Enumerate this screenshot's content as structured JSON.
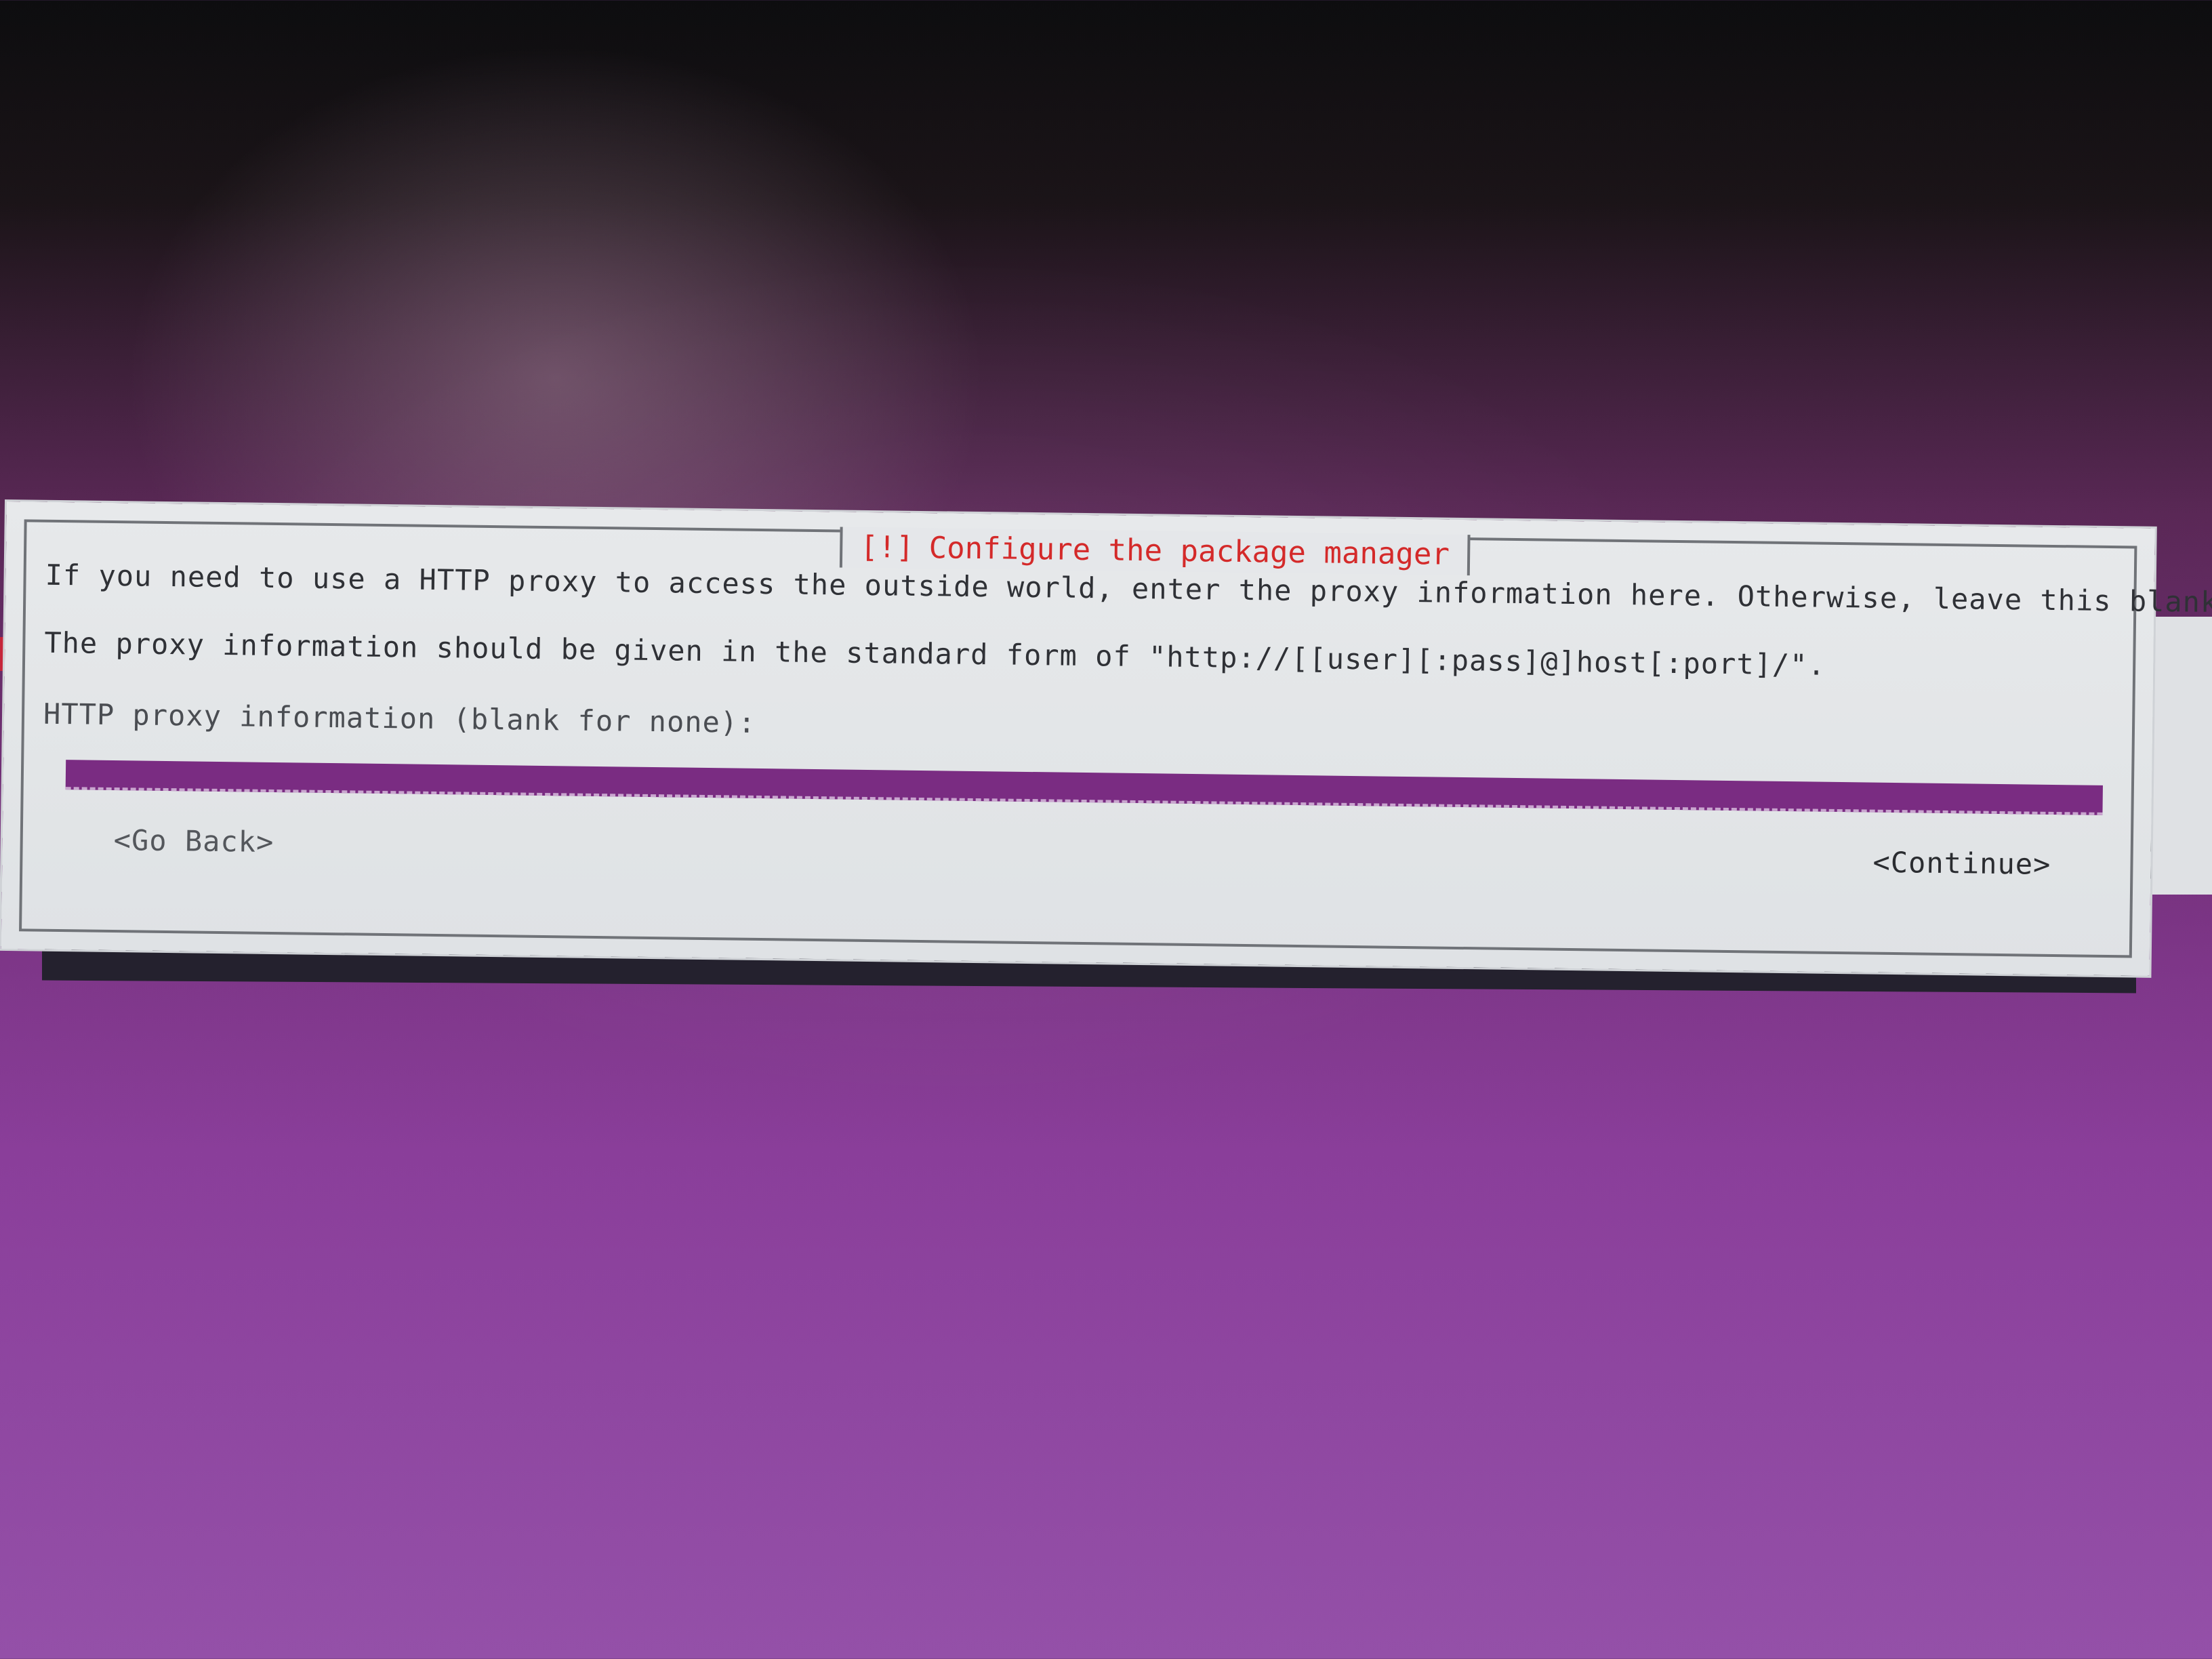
{
  "dialog": {
    "title_marker": "[!]",
    "title": "Configure the package manager",
    "description_line_1": "If you need to use a HTTP proxy to access the outside world, enter the proxy information here. Otherwise, leave this blank.",
    "description_line_2": "The proxy information should be given in the standard form of \"http://[[user][:pass]@]host[:port]/\".",
    "field_label": "HTTP proxy information (blank for none):",
    "field_value": "",
    "go_back_label": "<Go Back>",
    "continue_label": "<Continue>"
  },
  "colors": {
    "title_red": "#d42a2a",
    "dialog_background": "#e4e6e8",
    "input_purple": "#7a2c82",
    "screen_purple": "#8a3e9a"
  }
}
